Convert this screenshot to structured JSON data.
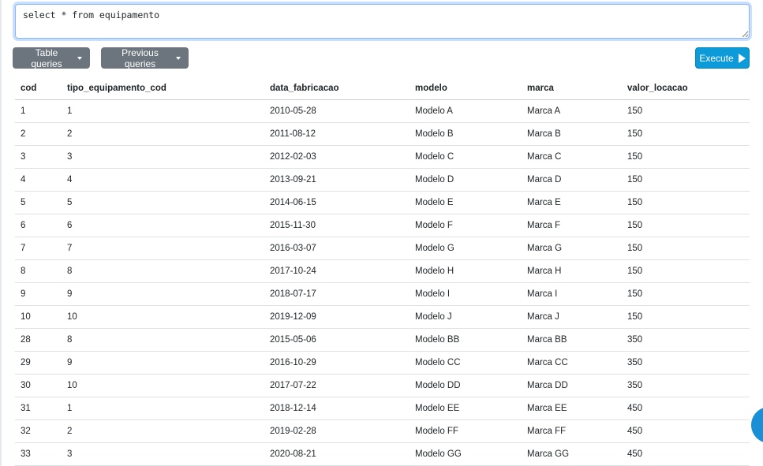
{
  "query": {
    "value": "select * from equipamento"
  },
  "toolbar": {
    "table_queries_label": "Table queries",
    "previous_queries_label": "Previous queries",
    "execute_label": "Execute"
  },
  "table": {
    "columns": [
      "cod",
      "tipo_equipamento_cod",
      "data_fabricacao",
      "modelo",
      "marca",
      "valor_locacao"
    ],
    "rows": [
      [
        "1",
        "1",
        "2010-05-28",
        "Modelo A",
        "Marca A",
        "150"
      ],
      [
        "2",
        "2",
        "2011-08-12",
        "Modelo B",
        "Marca B",
        "150"
      ],
      [
        "3",
        "3",
        "2012-02-03",
        "Modelo C",
        "Marca C",
        "150"
      ],
      [
        "4",
        "4",
        "2013-09-21",
        "Modelo D",
        "Marca D",
        "150"
      ],
      [
        "5",
        "5",
        "2014-06-15",
        "Modelo E",
        "Marca E",
        "150"
      ],
      [
        "6",
        "6",
        "2015-11-30",
        "Modelo F",
        "Marca F",
        "150"
      ],
      [
        "7",
        "7",
        "2016-03-07",
        "Modelo G",
        "Marca G",
        "150"
      ],
      [
        "8",
        "8",
        "2017-10-24",
        "Modelo H",
        "Marca H",
        "150"
      ],
      [
        "9",
        "9",
        "2018-07-17",
        "Modelo I",
        "Marca I",
        "150"
      ],
      [
        "10",
        "10",
        "2019-12-09",
        "Modelo J",
        "Marca J",
        "150"
      ],
      [
        "28",
        "8",
        "2015-05-06",
        "Modelo BB",
        "Marca BB",
        "350"
      ],
      [
        "29",
        "9",
        "2016-10-29",
        "Modelo CC",
        "Marca CC",
        "350"
      ],
      [
        "30",
        "10",
        "2017-07-22",
        "Modelo DD",
        "Marca DD",
        "350"
      ],
      [
        "31",
        "1",
        "2018-12-14",
        "Modelo EE",
        "Marca EE",
        "450"
      ],
      [
        "32",
        "2",
        "2019-02-28",
        "Modelo FF",
        "Marca FF",
        "450"
      ],
      [
        "33",
        "3",
        "2020-08-21",
        "Modelo GG",
        "Marca GG",
        "450"
      ]
    ]
  },
  "icons": {
    "dropdown": "caret-down-icon",
    "execute": "play-icon"
  },
  "colors": {
    "grey_button": "#6c757d",
    "execute_button": "#0d9ad8",
    "focus_border": "#86b7fe"
  }
}
